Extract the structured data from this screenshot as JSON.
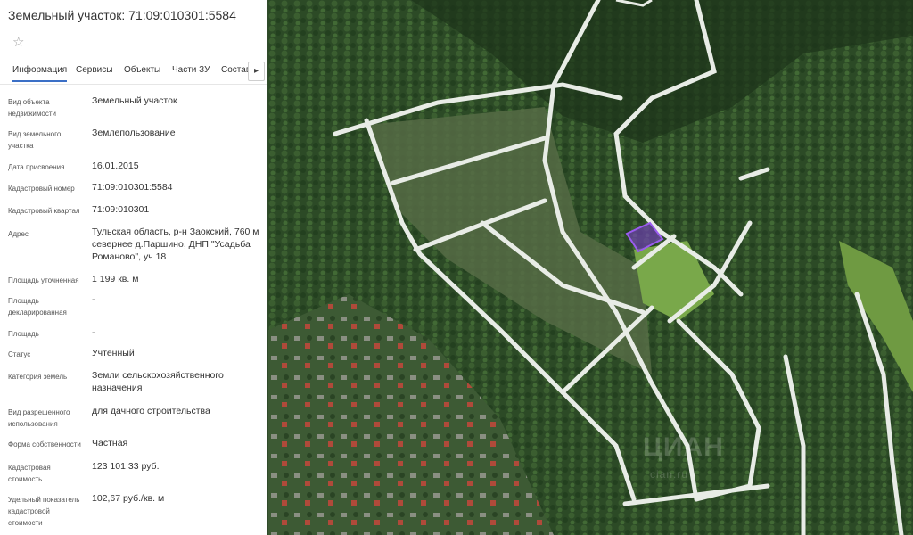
{
  "panel": {
    "title": "Земельный участок: 71:09:010301:5584",
    "favorite_icon": "star-outline-icon",
    "tabs": [
      "Информация",
      "Сервисы",
      "Объекты",
      "Части ЗУ",
      "Состав"
    ],
    "tabs_next_icon": "chevron-right-icon",
    "tabs_next_glyph": "▸",
    "fields": [
      {
        "label": "Вид объекта недвижимости",
        "value": "Земельный участок"
      },
      {
        "label": "Вид земельного участка",
        "value": "Землепользование"
      },
      {
        "label": "Дата присвоения",
        "value": "16.01.2015"
      },
      {
        "label": "Кадастровый номер",
        "value": "71:09:010301:5584"
      },
      {
        "label": "Кадастровый квартал",
        "value": "71:09:010301"
      },
      {
        "label": "Адрес",
        "value": "Тульская область, р-н Заокский, 760 м севернее д.Паршино, ДНП \"Усадьба Романово\", уч 18"
      },
      {
        "label": "Площадь уточненная",
        "value": "1 199 кв. м"
      },
      {
        "label": "Площадь декларированная",
        "value": "-"
      },
      {
        "label": "Площадь",
        "value": "-"
      },
      {
        "label": "Статус",
        "value": "Учтенный"
      },
      {
        "label": "Категория земель",
        "value": "Земли сельскохозяйственного назначения"
      },
      {
        "label": "Вид разрешенного использования",
        "value": "для дачного строительства"
      },
      {
        "label": "Форма собственности",
        "value": "Частная"
      },
      {
        "label": "Кадастровая стоимость",
        "value": "123 101,33 руб."
      },
      {
        "label": "Удельный показатель кадастровой стоимости",
        "value": "102,67 руб./кв. м"
      }
    ]
  },
  "map": {
    "watermark": "ЦИАН",
    "watermark_sub": "cian.ru",
    "colors": {
      "forest_dark": "#1f3a1c",
      "forest": "#35542c",
      "clearing": "#6b7a55",
      "road": "#e8ece6",
      "plot": "#7a3fc8",
      "grass": "#79a84a"
    }
  }
}
